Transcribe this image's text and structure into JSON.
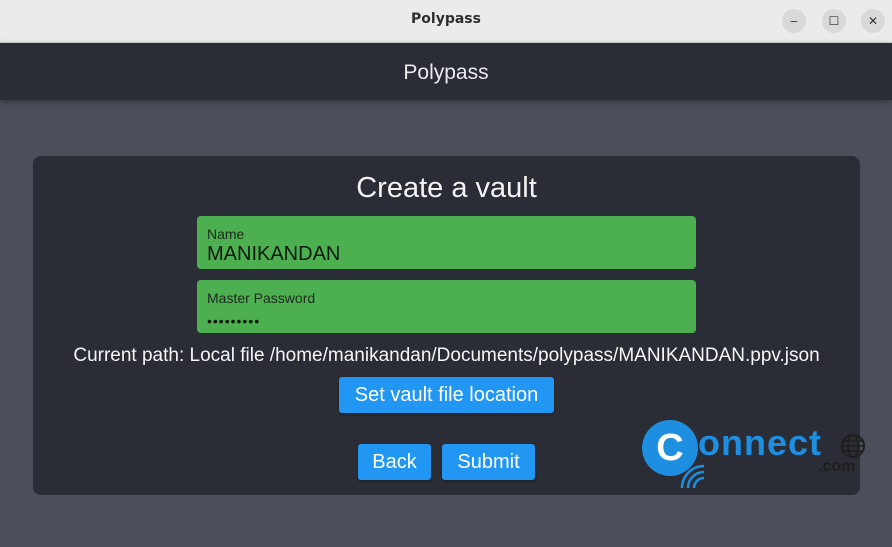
{
  "window": {
    "title": "Polypass",
    "controls": {
      "minimize_icon": "minimize-icon",
      "maximize_icon": "maximize-icon",
      "close_icon": "close-icon",
      "minimize_glyph": "‒",
      "maximize_glyph": "☐",
      "close_glyph": "✕"
    }
  },
  "header": {
    "title": "Polypass"
  },
  "form": {
    "heading": "Create a vault",
    "name_label": "Name",
    "name_value": "MANIKANDAN",
    "password_label": "Master Password",
    "password_value": "•••••••••",
    "current_path": "Current path: Local file /home/manikandan/Documents/polypass/MANIKANDAN.ppv.json",
    "set_location_label": "Set vault file location",
    "back_label": "Back",
    "submit_label": "Submit"
  },
  "watermark": {
    "letter": "C",
    "word": "onnect",
    "suffix": ".com"
  },
  "colors": {
    "titlebar_bg": "#ebebeb",
    "app_bg": "#4b4f59",
    "panel_bg": "#2b2d36",
    "field_bg": "#4caf50",
    "button_bg": "#2196f3",
    "watermark_blue": "#1e8fe0"
  }
}
